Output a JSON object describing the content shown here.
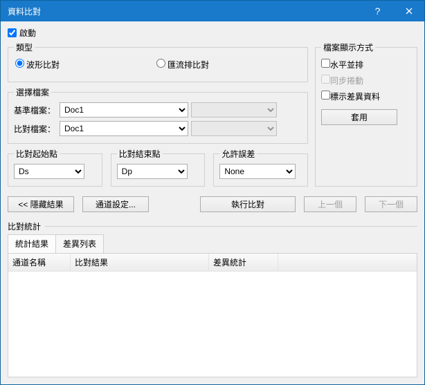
{
  "title": "資料比對",
  "enable_label": "啟動",
  "type": {
    "legend": "類型",
    "opt1": "波形比對",
    "opt2": "匯流排比對"
  },
  "files": {
    "legend": "選擇檔案",
    "base_label": "基準檔案：",
    "cmp_label": "比對檔案：",
    "base_value": "Doc1",
    "cmp_value": "Doc1",
    "aux_value": ""
  },
  "start": {
    "legend": "比對起始點",
    "value": "Ds"
  },
  "end": {
    "legend": "比對結束點",
    "value": "Dp"
  },
  "tol": {
    "legend": "允許誤差",
    "value": "None"
  },
  "display": {
    "legend": "檔案顯示方式",
    "side": "水平並排",
    "sync": "同步捲動",
    "mark": "標示差異資料",
    "apply": "套用"
  },
  "buttons": {
    "hide": "<< 隱藏結果",
    "channel": "通道設定...",
    "run": "執行比對",
    "prev": "上一個",
    "next": "下一個"
  },
  "stats": {
    "section": "比對統計",
    "tab_result": "統計結果",
    "tab_diff": "差異列表",
    "col_channel": "通道名稱",
    "col_result": "比對結果",
    "col_diffstat": "差異統計"
  }
}
